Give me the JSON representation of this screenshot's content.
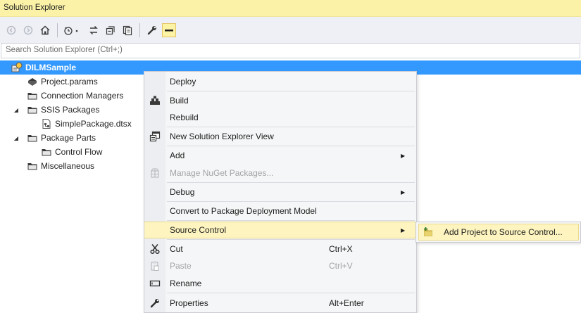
{
  "window": {
    "title": "Solution Explorer"
  },
  "toolbar": {
    "buttons": [
      "back-icon",
      "forward-icon",
      "home-icon",
      "history-icon",
      "sync-icon",
      "collapse-all-icon",
      "show-all-files-icon",
      "properties-wrench-icon",
      "preview-selected-icon"
    ]
  },
  "search": {
    "placeholder": "Search Solution Explorer (Ctrl+;)"
  },
  "tree": {
    "root": "DILMSample",
    "items": [
      {
        "label": "Project.params"
      },
      {
        "label": "Connection Managers"
      },
      {
        "label": "SSIS Packages"
      },
      {
        "label": "SimplePackage.dtsx"
      },
      {
        "label": "Package Parts"
      },
      {
        "label": "Control Flow"
      },
      {
        "label": "Miscellaneous"
      }
    ]
  },
  "context_menu": {
    "items": [
      {
        "label": "Deploy"
      },
      {
        "label": "Build"
      },
      {
        "label": "Rebuild"
      },
      {
        "label": "New Solution Explorer View"
      },
      {
        "label": "Add"
      },
      {
        "label": "Manage NuGet Packages..."
      },
      {
        "label": "Debug"
      },
      {
        "label": "Convert to Package Deployment Model"
      },
      {
        "label": "Source Control"
      },
      {
        "label": "Cut",
        "shortcut": "Ctrl+X"
      },
      {
        "label": "Paste",
        "shortcut": "Ctrl+V"
      },
      {
        "label": "Rename"
      },
      {
        "label": "Properties",
        "shortcut": "Alt+Enter"
      }
    ]
  },
  "submenu": {
    "items": [
      {
        "label": "Add Project to Source Control..."
      }
    ]
  },
  "colors": {
    "title_bg": "#fbf2a8",
    "selection": "#3399ff",
    "menu_highlight": "#fdf4bf",
    "toolbar_bg": "#eef0f5"
  }
}
